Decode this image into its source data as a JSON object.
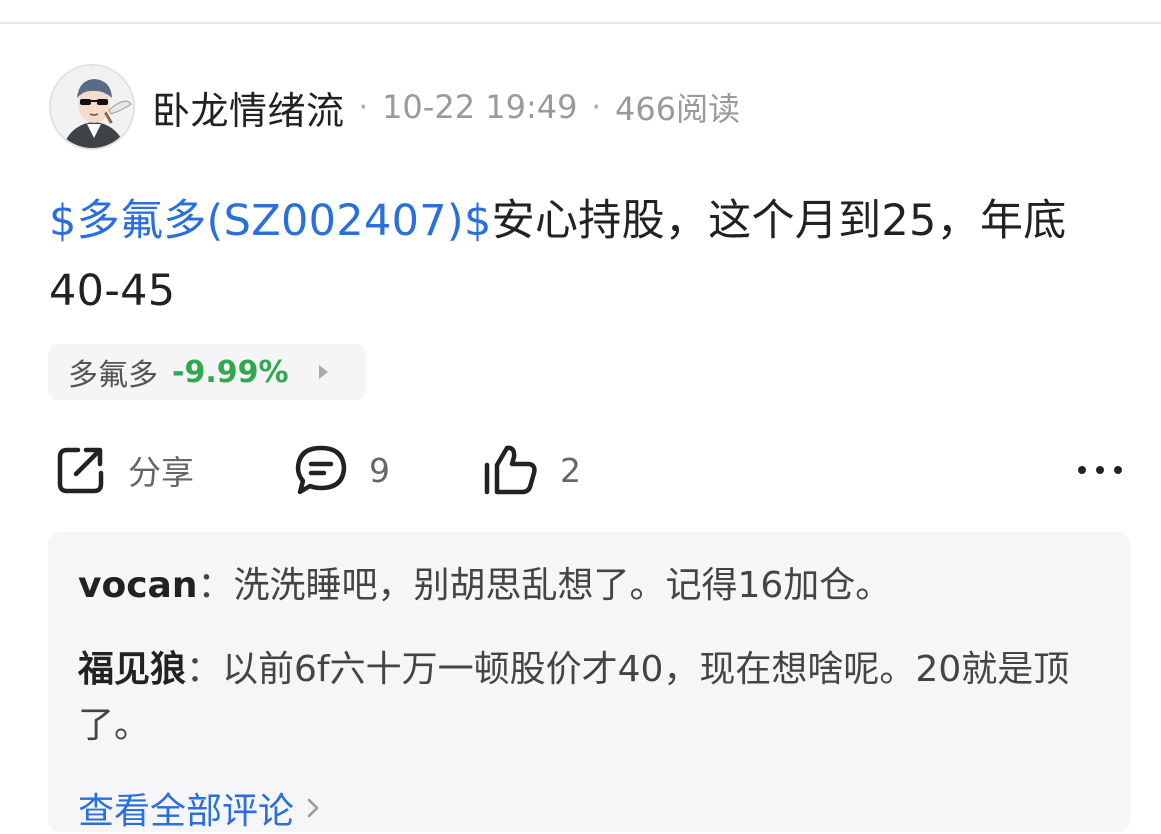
{
  "post": {
    "author": "卧龙情绪流",
    "date": "10-22 19:49",
    "reads": "466阅读",
    "separator": "·",
    "stock_link": "$多氟多(SZ002407)$",
    "text": "安心持股，这个月到25，年底40-45"
  },
  "stock_chip": {
    "name": "多氟多",
    "change": "-9.99%",
    "change_color": "#2fa84f"
  },
  "actions": {
    "share_label": "分享",
    "comment_count": "9",
    "like_count": "2"
  },
  "comments": [
    {
      "author": "vocan",
      "text": "洗洗睡吧，别胡思乱想了。记得16加仓。"
    },
    {
      "author": "福见狼",
      "text": "以前6f六十万一顿股价才40，现在想啥呢。20就是顶了。"
    }
  ],
  "comments_footer": {
    "view_all": "查看全部评论"
  },
  "colors": {
    "link_blue": "#2a6fdb",
    "text_dark": "#222222",
    "meta_gray": "#9a9a9a"
  },
  "icons": [
    "avatar-image",
    "share-icon",
    "comment-icon",
    "like-icon",
    "more-icon",
    "chevron-right-icon"
  ]
}
